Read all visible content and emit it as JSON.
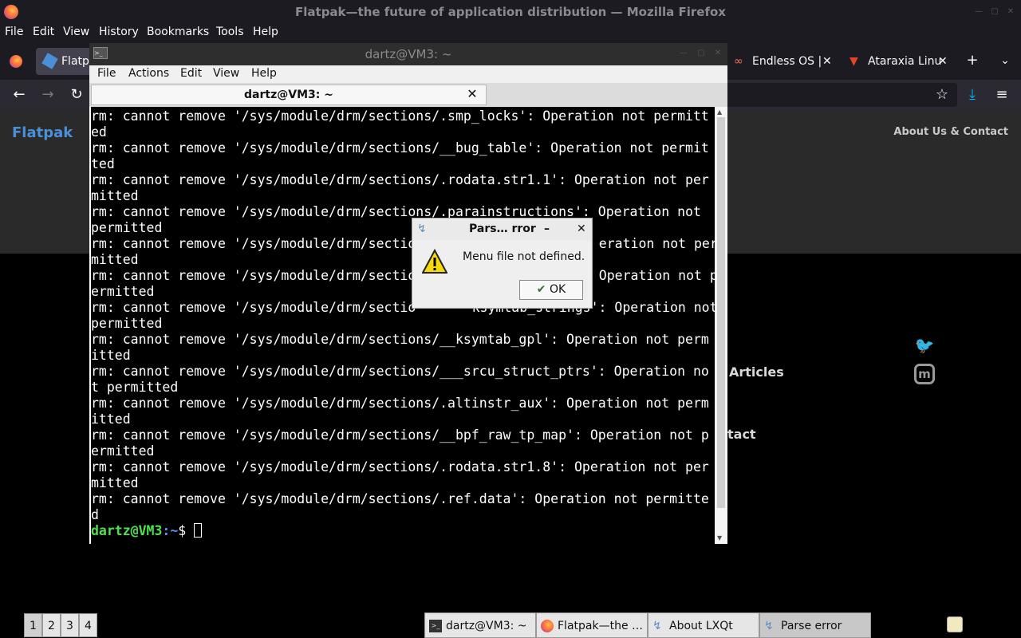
{
  "firefox": {
    "window_title": "Flatpak—the future of application distribution — Mozilla Firefox",
    "menu": [
      "File",
      "Edit",
      "View",
      "History",
      "Bookmarks",
      "Tools",
      "Help"
    ],
    "tabs": [
      {
        "label": "Flatp"
      },
      {
        "label": "Endless OS |"
      },
      {
        "label": "Ataraxia Linu"
      }
    ]
  },
  "website": {
    "brand": "Flatpak",
    "nav_about": "About Us & Contact",
    "partial_links": [
      "Articles",
      "tact"
    ]
  },
  "terminal": {
    "window_title": "dartz@VM3: ~",
    "menu": [
      "File",
      "Actions",
      "Edit",
      "View",
      "Help"
    ],
    "tab_label": "dartz@VM3: ~",
    "lines": [
      "rm: cannot remove '/sys/module/drm/sections/.smp_locks': Operation not permitt",
      "ed",
      "rm: cannot remove '/sys/module/drm/sections/__bug_table': Operation not permit",
      "ted",
      "rm: cannot remove '/sys/module/drm/sections/.rodata.str1.1': Operation not per",
      "mitted",
      "rm: cannot remove '/sys/module/drm/sections/.parainstructions': Operation not ",
      "permitted",
      "rm: cannot remove '/sys/module/drm/sectio",
      "mitted",
      "rm: cannot remove '/sys/module/drm/sectio",
      "ermitted",
      "rm: cannot remove '/sys/module/drm/sectio",
      "permitted",
      "rm: cannot remove '/sys/module/drm/sections/__ksymtab_gpl': Operation not perm",
      "itted",
      "rm: cannot remove '/sys/module/drm/sections/___srcu_struct_ptrs': Operation no",
      "t permitted",
      "rm: cannot remove '/sys/module/drm/sections/.altinstr_aux': Operation not perm",
      "itted",
      "rm: cannot remove '/sys/module/drm/sections/__bpf_raw_tp_map': Operation not p",
      "ermitted",
      "rm: cannot remove '/sys/module/drm/sections/.rodata.str1.8': Operation not per",
      "mitted",
      "rm: cannot remove '/sys/module/drm/sections/.ref.data': Operation not permitte",
      "d"
    ],
    "partial_right": [
      {
        "row": 8,
        "text": "eration not per"
      },
      {
        "row": 10,
        "text": "Operation not p"
      },
      {
        "row": 12,
        "text": "ksymtab_strings': Operation not"
      }
    ],
    "prompt_user": "dartz@VM3",
    "prompt_path": ":~",
    "prompt_symbol": "$ "
  },
  "dialog": {
    "title": "Pars… rror",
    "message": "Menu file not defined.",
    "ok_label": "OK"
  },
  "panel": {
    "workspaces": [
      "1",
      "2",
      "3",
      "4"
    ],
    "tasks": [
      {
        "label": "dartz@VM3: ~"
      },
      {
        "label": "Flatpak—the …"
      },
      {
        "label": "About LXQt"
      },
      {
        "label": "Parse error"
      }
    ]
  }
}
